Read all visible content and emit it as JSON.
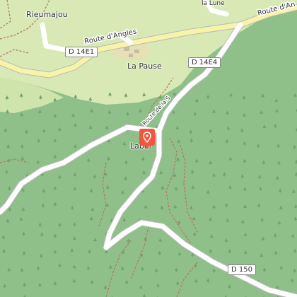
{
  "places": {
    "rieumajou": "Rieumajou",
    "la_pause": "La Pause",
    "label_village": "Label",
    "la_lune": "la Lune"
  },
  "roads": {
    "route_angles_1": "Route d'Angles",
    "route_angles_2": "Route d'Angles",
    "route_souque": "Route de la Souque",
    "d14e1": "D 14E1",
    "d14e4": "D 14E4",
    "d150": "D 150"
  },
  "marker": {
    "icon": "map-pin-icon",
    "color": "#f2553b"
  },
  "colors": {
    "forest": "#8fc08a",
    "meadow": "#d8e9b5",
    "road_fill": "#ffffff",
    "road_casing": "#b8b8b8",
    "main_road": "#f7f3a8",
    "path": "#b6735e"
  }
}
